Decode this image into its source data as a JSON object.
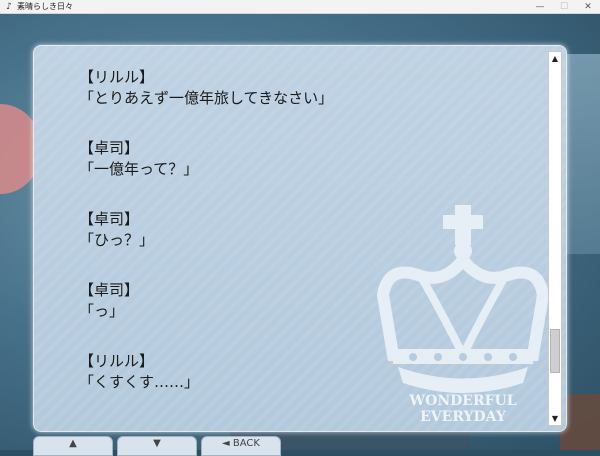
{
  "window": {
    "title": "素晴らしき日々",
    "icon": "music-note-icon",
    "minimize_glyph": "—",
    "maximize_glyph": "☐",
    "close_glyph": "✕"
  },
  "log": {
    "entries": [
      {
        "speaker": "【リルル】",
        "line": "「とりあえず一億年旅してきなさい」"
      },
      {
        "speaker": "【卓司】",
        "line": "「一億年って？」"
      },
      {
        "speaker": "【卓司】",
        "line": "「ひっ？」"
      },
      {
        "speaker": "【卓司】",
        "line": "「っ」"
      },
      {
        "speaker": "【リルル】",
        "line": "「くすくす……」"
      }
    ]
  },
  "watermark": {
    "line1": "WONDERFUL",
    "line2": "EVERYDAY",
    "icon": "crown-icon"
  },
  "scrollbar": {
    "up_glyph": "▲",
    "down_glyph": "▼",
    "position": 0.87
  },
  "controls": {
    "up_label": "▲",
    "down_label": "▼",
    "back_label": "◄ BACK"
  },
  "colors": {
    "panel": "#b8ccdf",
    "text": "#1a1a1a",
    "watermark": "#eef4fa"
  }
}
